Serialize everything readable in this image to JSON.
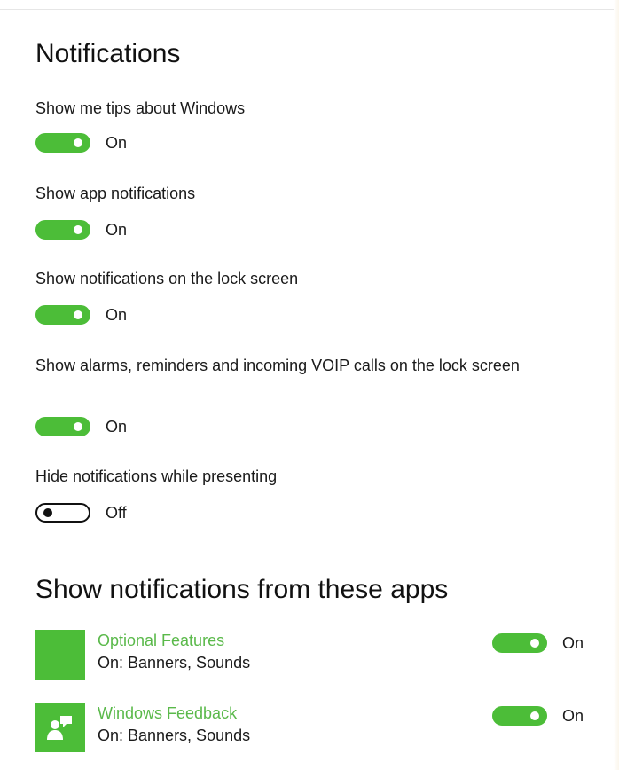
{
  "notifications": {
    "title": "Notifications",
    "settings": [
      {
        "label": "Show me tips about Windows",
        "on": true,
        "state": "On"
      },
      {
        "label": "Show app notifications",
        "on": true,
        "state": "On"
      },
      {
        "label": "Show notifications on the lock screen",
        "on": true,
        "state": "On"
      },
      {
        "label": "Show alarms, reminders and incoming VOIP calls on the lock screen",
        "on": true,
        "state": "On"
      },
      {
        "label": "Hide notifications while presenting",
        "on": false,
        "state": "Off"
      }
    ]
  },
  "apps": {
    "title": "Show notifications from these apps",
    "items": [
      {
        "name": "Optional Features",
        "detail": "On: Banners, Sounds",
        "icon": "blank-app-icon",
        "on": true,
        "state": "On"
      },
      {
        "name": "Windows Feedback",
        "detail": "On: Banners, Sounds",
        "icon": "feedback-person-icon",
        "on": true,
        "state": "On"
      }
    ]
  },
  "colors": {
    "accent": "#4cbd38",
    "app_name": "#5ab94a",
    "off_toggle_border": "#111111"
  }
}
